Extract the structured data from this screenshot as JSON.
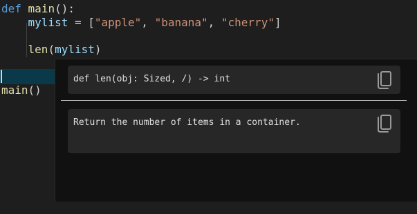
{
  "editor": {
    "line1": {
      "keyword": "def",
      "func": "main",
      "rest": "():"
    },
    "line2": {
      "indent": "    ",
      "var": "mylist",
      "eq": " = [",
      "s1": "\"apple\"",
      "c1": ", ",
      "s2": "\"banana\"",
      "c2": ", ",
      "s3": "\"cherry\"",
      "close": "]"
    },
    "line4": {
      "indent": "    ",
      "func": "len",
      "open": "(",
      "arg": "mylist",
      "close": ")"
    },
    "line6": {
      "func": "main",
      "rest": "()"
    }
  },
  "hover": {
    "signature": "def len(obj: Sized, /) -> int",
    "doc": "Return the number of items in a container.",
    "copy_icon": "copy-icon"
  }
}
